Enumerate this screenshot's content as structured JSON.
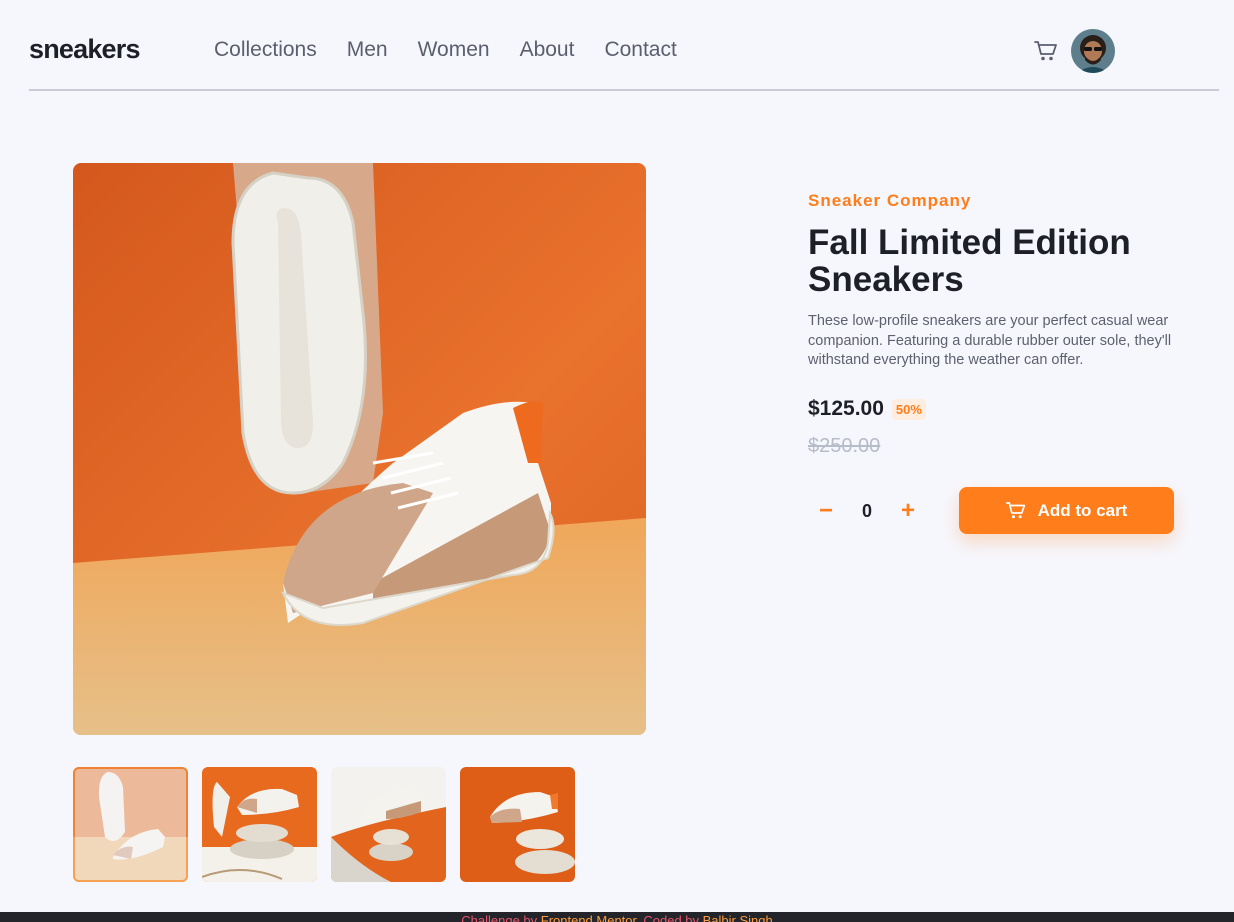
{
  "brand": {
    "logo": "sneakers"
  },
  "nav": [
    "Collections",
    "Men",
    "Women",
    "About",
    "Contact"
  ],
  "header": {
    "cart_icon": "cart-icon",
    "avatar_icon": "avatar"
  },
  "gallery": {
    "main_image": "sneaker-product-photo",
    "thumbnails": [
      "product-thumbnail-1",
      "product-thumbnail-2",
      "product-thumbnail-3",
      "product-thumbnail-4"
    ],
    "active_thumbnail": 0
  },
  "product": {
    "company": "Sneaker Company",
    "title": "Fall Limited Edition Sneakers",
    "description": "These low-profile sneakers are your perfect casual wear companion. Featuring a durable rubber outer sole, they'll withstand everything the weather can offer.",
    "price": "$125.00",
    "discount": "50%",
    "old_price": "$250.00"
  },
  "cart": {
    "minus": "−",
    "quantity": "0",
    "plus": "+",
    "add_label": "Add to cart"
  },
  "footer": {
    "prefix": "Challenge by ",
    "challenge_link": "Frontend Mentor",
    "middle": ". Coded by ",
    "author_link": "Balbir Singh"
  },
  "colors": {
    "accent": "#ff7d1a",
    "accent_light": "#ffede0",
    "text_dark": "#1d2026",
    "text_muted": "#5d616e",
    "background": "#f6f7fd"
  }
}
